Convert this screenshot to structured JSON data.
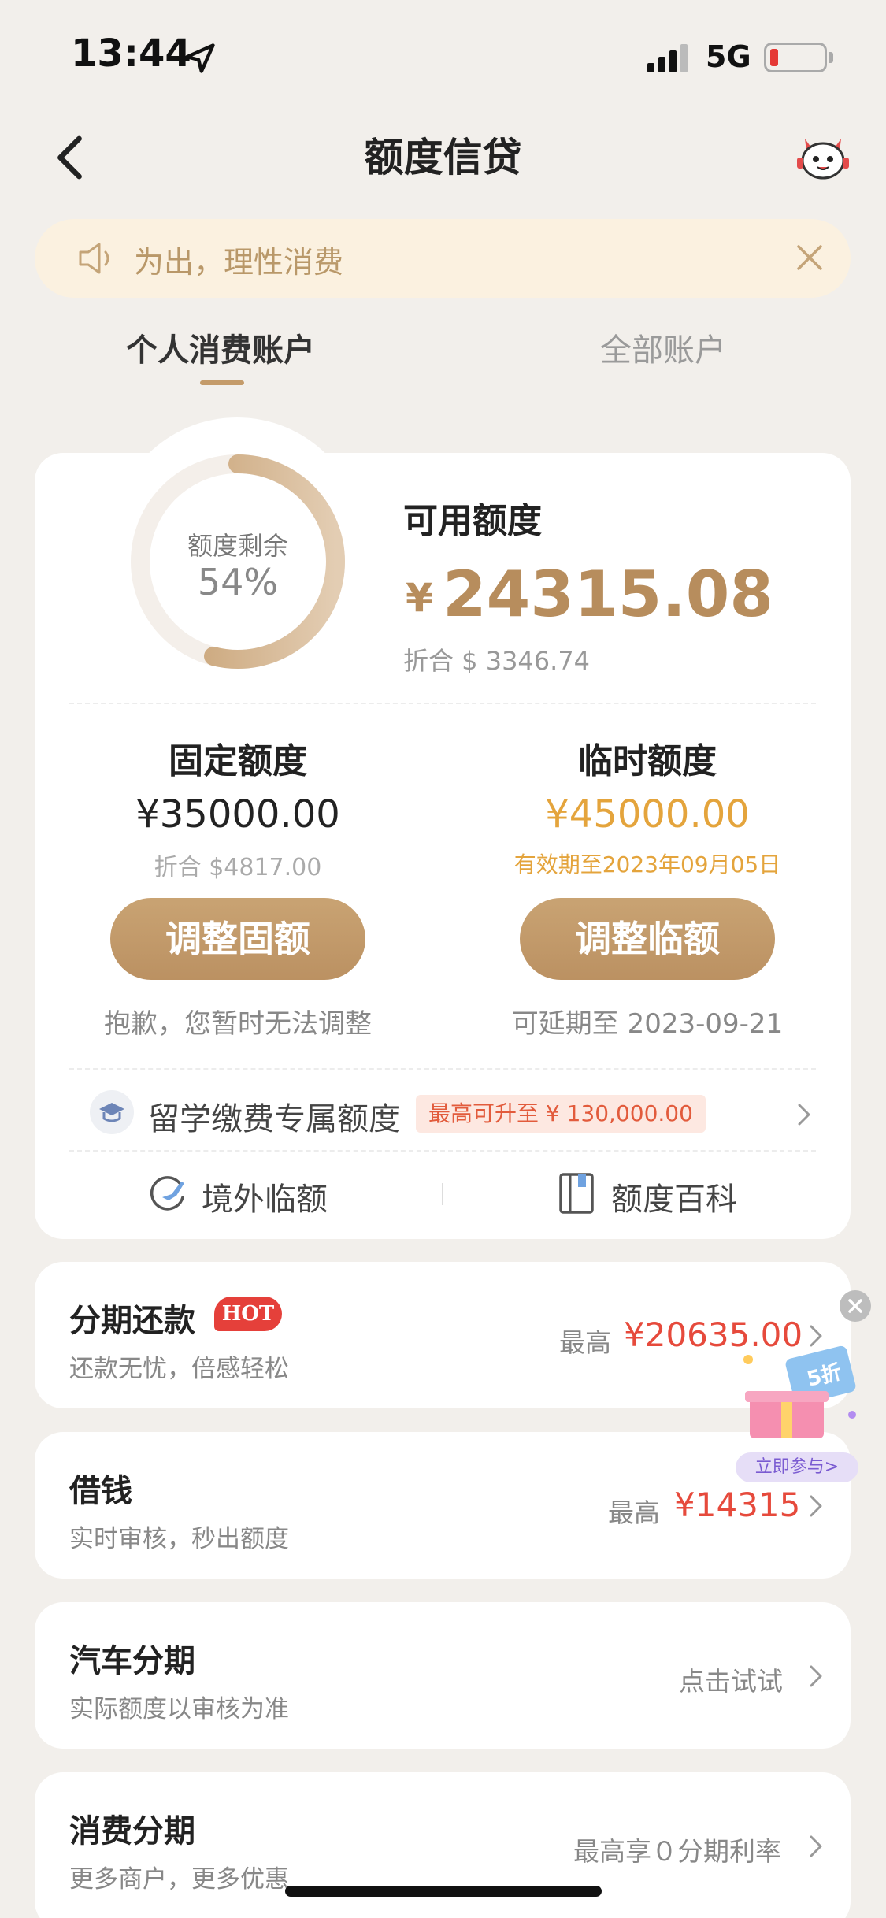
{
  "status_bar": {
    "time": "13:44",
    "network": "5G",
    "battery_color": "#e53935"
  },
  "nav": {
    "title": "额度信贷",
    "back_icon": "chevron-left-icon",
    "service_icon": "mascot-icon"
  },
  "notice": {
    "text": "为出，理性消费",
    "icon": "speaker-icon",
    "close_icon": "close-icon"
  },
  "tabs": [
    {
      "label": "个人消费账户",
      "active": true
    },
    {
      "label": "全部账户",
      "active": false
    }
  ],
  "credit": {
    "ring_label": "额度剩余",
    "ring_percent": "54%",
    "ring_fraction": 0.54,
    "available_label": "可用额度",
    "currency_symbol": "¥",
    "available_amount": "24315.08",
    "available_usd": "折合 $ 3346.74",
    "accent_color": "#b78d5d"
  },
  "fixed": {
    "label": "固定额度",
    "amount": "¥35000.00",
    "usd": "折合 $4817.00",
    "button": "调整固额",
    "note": "抱歉，您暂时无法调整"
  },
  "temporary": {
    "label": "临时额度",
    "amount": "¥45000.00",
    "valid": "有效期至2023年09月05日",
    "button": "调整临额",
    "note": "可延期至 2023-09-21",
    "color": "#e4a43c"
  },
  "study": {
    "text": "留学缴费专属额度",
    "badge": "最高可升至 ¥ 130,000.00"
  },
  "quick_links": [
    {
      "label": "境外临额",
      "icon": "plane-loop-icon"
    },
    {
      "label": "额度百科",
      "icon": "book-icon"
    }
  ],
  "list": [
    {
      "title": "分期还款",
      "badge": "HOT",
      "subtitle": "还款无忧，倍感轻松",
      "right_label": "最高",
      "right_amount": "¥20635.00"
    },
    {
      "title": "借钱",
      "subtitle": "实时审核，秒出额度",
      "right_label": "最高",
      "right_amount": "¥14315"
    },
    {
      "title": "汽车分期",
      "subtitle": "实际额度以审核为准",
      "right_label": "点击试试"
    },
    {
      "title": "消费分期",
      "subtitle": "更多商户，更多优惠",
      "right_label": "最高享０分期利率"
    }
  ],
  "promo": {
    "discount": "5折",
    "button": "立即参与>"
  }
}
